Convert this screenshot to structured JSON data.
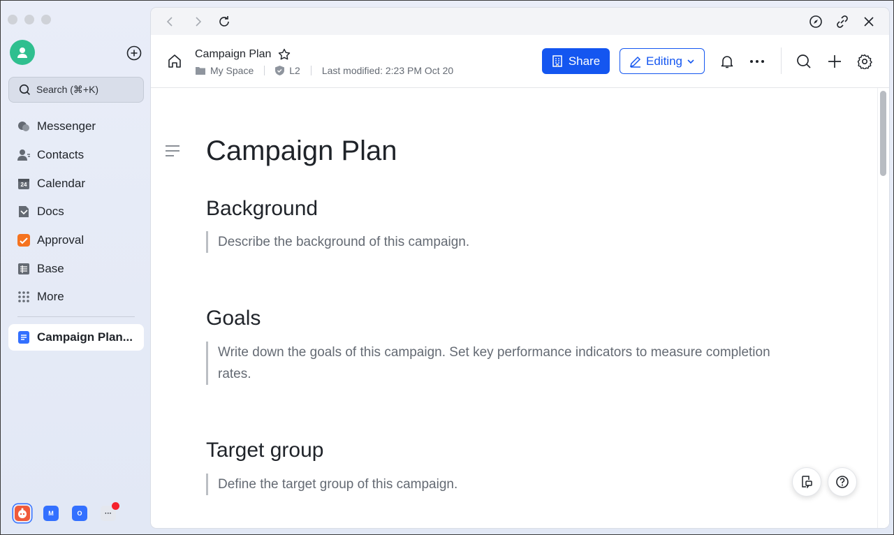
{
  "sidebar": {
    "search_placeholder": "Search (⌘+K)",
    "items": [
      {
        "label": "Messenger",
        "icon": "messenger-icon"
      },
      {
        "label": "Contacts",
        "icon": "contacts-icon"
      },
      {
        "label": "Calendar",
        "icon": "calendar-icon"
      },
      {
        "label": "Docs",
        "icon": "docs-icon"
      },
      {
        "label": "Approval",
        "icon": "approval-icon"
      },
      {
        "label": "Base",
        "icon": "base-icon"
      },
      {
        "label": "More",
        "icon": "more-grid-icon"
      }
    ],
    "active_doc": "Campaign Plan...",
    "calendar_day": "24",
    "dock": [
      {
        "label": "",
        "color": "#f05a3a"
      },
      {
        "label": "M",
        "color": "#3370ff"
      },
      {
        "label": "O",
        "color": "#3370ff"
      },
      {
        "label": "···",
        "color": "#e4e7ee"
      }
    ]
  },
  "header": {
    "title": "Campaign Plan",
    "location": "My Space",
    "security_level": "L2",
    "last_modified": "Last modified: 2:23 PM Oct 20",
    "share_label": "Share",
    "editing_label": "Editing"
  },
  "document": {
    "title": "Campaign Plan",
    "sections": [
      {
        "heading": "Background",
        "body": "Describe the background of this campaign."
      },
      {
        "heading": "Goals",
        "body": "Write down the goals of this campaign. Set key performance indicators to measure completion rates."
      },
      {
        "heading": "Target group",
        "body": "Define the target group of this campaign."
      }
    ]
  },
  "colors": {
    "accent": "#1456f0",
    "avatar": "#2fbf8f",
    "approval": "#f5731f",
    "notification_dot": "#f5222d"
  }
}
